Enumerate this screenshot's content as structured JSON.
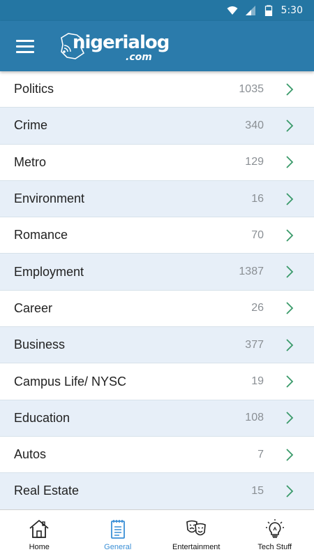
{
  "status": {
    "time": "5:30"
  },
  "header": {
    "logo_text": "nigerialog",
    "logo_sub": ".com"
  },
  "categories": [
    {
      "label": "Politics",
      "count": "1035"
    },
    {
      "label": "Crime",
      "count": "340"
    },
    {
      "label": "Metro",
      "count": "129"
    },
    {
      "label": "Environment",
      "count": "16"
    },
    {
      "label": "Romance",
      "count": "70"
    },
    {
      "label": "Employment",
      "count": "1387"
    },
    {
      "label": "Career",
      "count": "26"
    },
    {
      "label": "Business",
      "count": "377"
    },
    {
      "label": "Campus Life/ NYSC",
      "count": "19"
    },
    {
      "label": "Education",
      "count": "108"
    },
    {
      "label": "Autos",
      "count": "7"
    },
    {
      "label": "Real Estate",
      "count": "15"
    }
  ],
  "bottom_nav": [
    {
      "label": "Home",
      "icon": "home-icon"
    },
    {
      "label": "General",
      "icon": "notepad-icon",
      "active": true
    },
    {
      "label": "Entertainment",
      "icon": "theater-masks-icon"
    },
    {
      "label": "Tech Stuff",
      "icon": "lightbulb-icon"
    }
  ],
  "colors": {
    "primary": "#2b7bab",
    "status_bar": "#2476a3",
    "row_alt": "#e7eff8",
    "chevron": "#3a9a6a",
    "active_tab": "#3a8fd6"
  }
}
